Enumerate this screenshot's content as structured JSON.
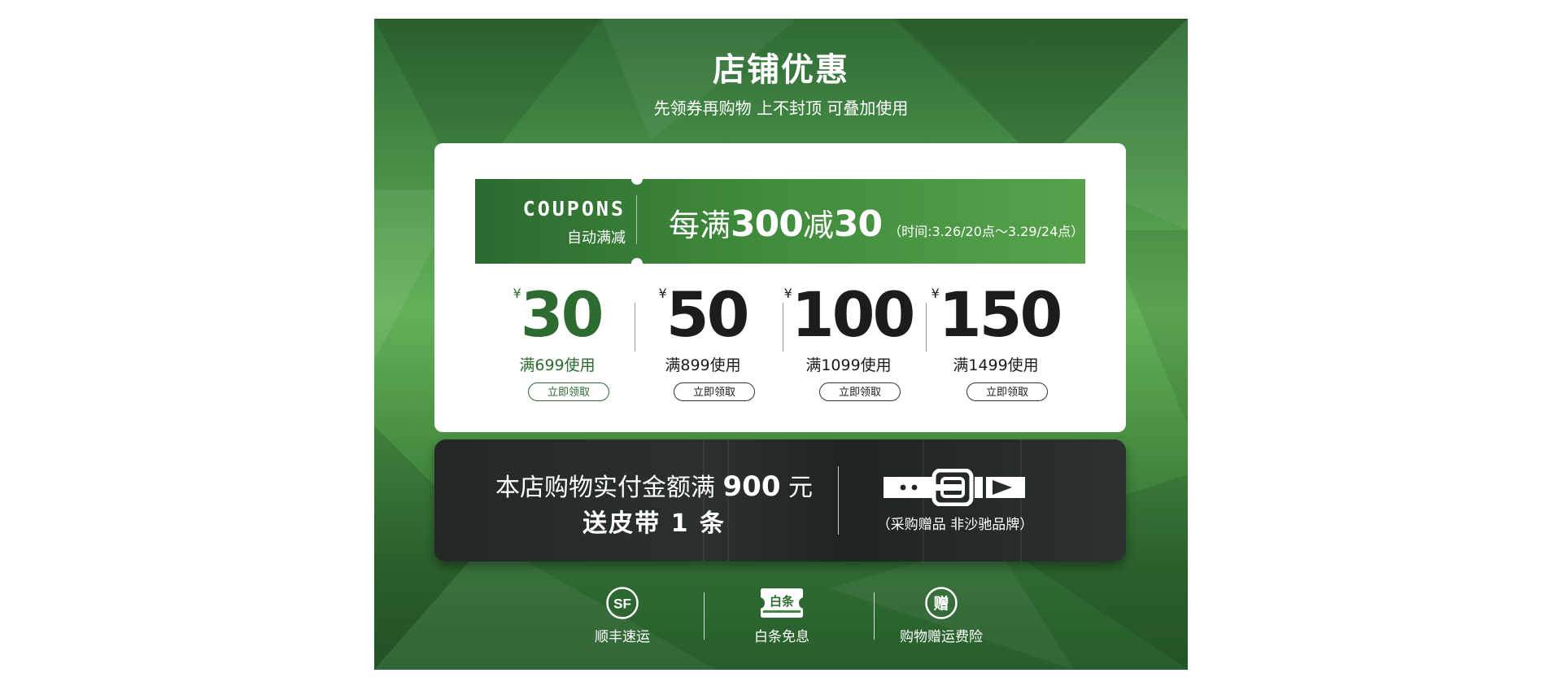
{
  "header": {
    "title": "店铺优惠",
    "subtitle": "先领券再购物 上不封顶 可叠加使用"
  },
  "coupon_banner": {
    "brand_word": "COUPONS",
    "brand_sub": "自动满减",
    "rule_prefix": "每满",
    "rule_threshold": "300",
    "rule_mid": "减",
    "rule_discount": "30",
    "rule_time": "（时间:3.26/20点～3.29/24点）"
  },
  "tiers": [
    {
      "currency": "¥",
      "amount": "30",
      "condition": "满699使用",
      "button": "立即领取",
      "highlighted": true
    },
    {
      "currency": "¥",
      "amount": "50",
      "condition": "满899使用",
      "button": "立即领取",
      "highlighted": false
    },
    {
      "currency": "¥",
      "amount": "100",
      "condition": "满1099使用",
      "button": "立即领取",
      "highlighted": false
    },
    {
      "currency": "¥",
      "amount": "150",
      "condition": "满1499使用",
      "button": "立即领取",
      "highlighted": false
    }
  ],
  "gift": {
    "line1_prefix": "本店购物实付金额满",
    "line1_amount": "900",
    "line1_suffix": "元",
    "line2_prefix": "送皮带",
    "line2_count": "1",
    "line2_suffix": "条",
    "note": "（采购赠品 非沙驰品牌）",
    "icon": "belt-icon"
  },
  "services": [
    {
      "icon": "sf-express-icon",
      "icon_text": "SF",
      "label": "顺丰速运"
    },
    {
      "icon": "baitiao-icon",
      "icon_text": "白条",
      "label": "白条免息"
    },
    {
      "icon": "gift-icon",
      "icon_text": "赠",
      "label": "购物赠运费险"
    }
  ],
  "colors": {
    "brand_green": "#2d6b30",
    "banner_green": "#3f8a3c",
    "dark_panel": "#262b29",
    "white": "#ffffff"
  }
}
